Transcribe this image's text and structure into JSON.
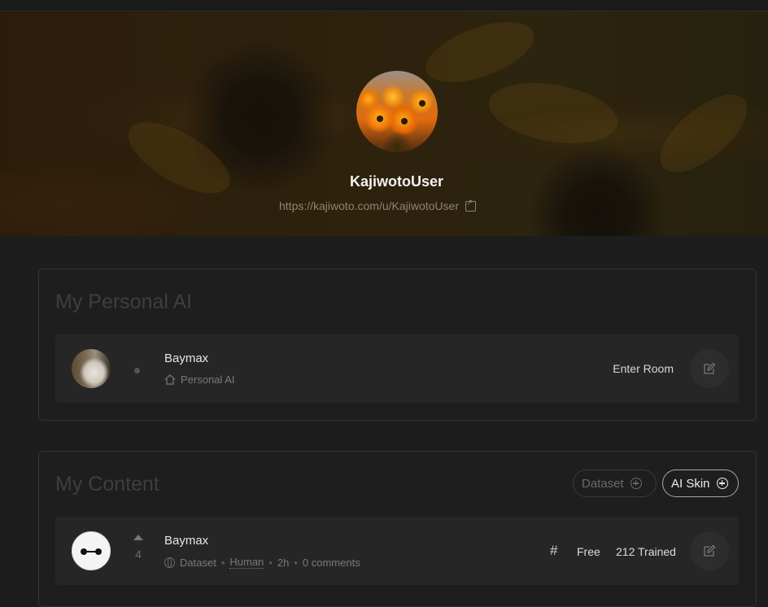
{
  "profile": {
    "username": "KajiwotoUser",
    "url": "https://kajiwoto.com/u/KajiwotoUser"
  },
  "personal_ai": {
    "title": "My Personal AI",
    "item": {
      "name": "Baymax",
      "type": "Personal AI",
      "action": "Enter Room"
    }
  },
  "content": {
    "title": "My Content",
    "buttons": {
      "dataset": "Dataset",
      "ai_skin": "AI Skin"
    },
    "item": {
      "name": "Baymax",
      "votes": "4",
      "type": "Dataset",
      "audience": "Human",
      "age": "2h",
      "comments": "0 comments",
      "hash": "#",
      "price": "Free",
      "trained": "212 Trained"
    }
  },
  "icons": {
    "external_link": "external-link-icon",
    "home": "home-icon",
    "globe": "globe-icon",
    "edit": "edit-icon",
    "plus": "plus-circle-icon",
    "upvote": "upvote-arrow-icon"
  },
  "separator": "•"
}
